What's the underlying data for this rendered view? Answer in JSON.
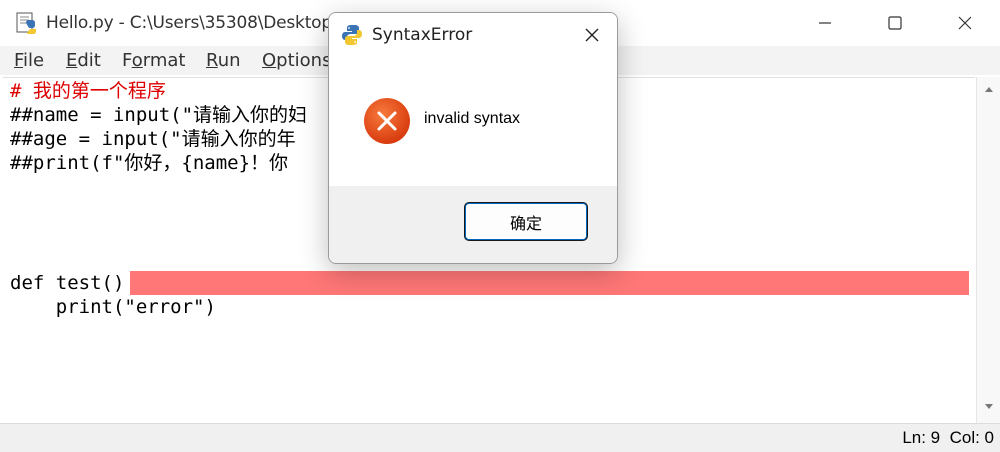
{
  "window": {
    "title": "Hello.py - C:\\Users\\35308\\Desktop\\",
    "icons": {
      "app": "python-idle-icon",
      "minimize": "minimize-icon",
      "maximize": "maximize-icon",
      "close": "close-icon"
    }
  },
  "menu": {
    "items": [
      {
        "key": "F",
        "rest": "ile"
      },
      {
        "key": "E",
        "rest": "dit"
      },
      {
        "key": "",
        "pre": "F",
        "key2": "o",
        "rest": "rmat"
      },
      {
        "key": "R",
        "rest": "un"
      },
      {
        "key": "O",
        "rest": "ptions"
      }
    ]
  },
  "editor": {
    "lines": [
      "# 我的第一个程序",
      "##name = input(\"请输入你的妇",
      "##age = input(\"请输入你的年",
      "##print(f\"你好，{name}！你",
      "",
      "",
      "",
      "def test()",
      "    print(\"error\")"
    ],
    "error_highlight_color": "#ff7777",
    "comment_color": "#dd0000"
  },
  "status": {
    "text": "Ln: 9  Col: 0"
  },
  "dialog": {
    "title": "SyntaxError",
    "message": "invalid syntax",
    "ok_label": "确定",
    "icons": {
      "app": "python-icon",
      "close": "close-icon",
      "error": "error-icon"
    },
    "error_color": "#e03c10"
  }
}
